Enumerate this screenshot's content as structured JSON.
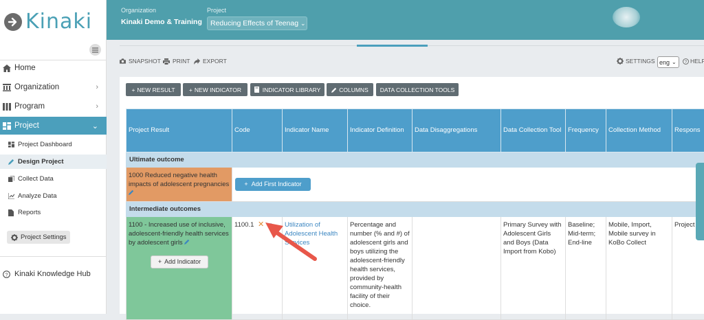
{
  "app": {
    "logo_text": "Kinaki"
  },
  "sidebar": {
    "items": [
      {
        "label": "Home"
      },
      {
        "label": "Organization"
      },
      {
        "label": "Program"
      },
      {
        "label": "Project"
      }
    ],
    "sub_items": [
      {
        "label": "Project Dashboard"
      },
      {
        "label": "Design Project"
      },
      {
        "label": "Collect Data"
      },
      {
        "label": "Analyze Data"
      },
      {
        "label": "Reports"
      }
    ],
    "project_settings": "Project Settings",
    "knowledge_hub": "Kinaki Knowledge Hub"
  },
  "header": {
    "org_label": "Organization",
    "org_value": "Kinaki Demo & Training",
    "project_label": "Project",
    "project_value": "Reducing Effects of Teenag"
  },
  "toolbar": {
    "snapshot": "SNAPSHOT",
    "print": "PRINT",
    "export": "EXPORT",
    "settings": "SETTINGS",
    "language": "eng",
    "help": "HELP"
  },
  "actions": {
    "new_result": "NEW RESULT",
    "new_indicator": "NEW INDICATOR",
    "indicator_library": "INDICATOR LIBRARY",
    "columns": "COLUMNS",
    "data_collection_tools": "DATA COLLECTION TOOLS"
  },
  "table": {
    "headers": [
      "Project Result",
      "Code",
      "Indicator Name",
      "Indicator Definition",
      "Data Disaggregations",
      "Data Collection Tool",
      "Frequency",
      "Collection Method",
      "Respons"
    ],
    "group1": "Ultimate outcome",
    "result1": "1000 Reduced negative health impacts of adolescent pregnancies",
    "add_first_indicator": "Add First Indicator",
    "group2": "Intermediate outcomes",
    "result2": "1100 - Increased use of inclusive, adolescent-friendly health services by adolescent girls",
    "add_indicator": "Add Indicator",
    "row": {
      "code": "1100.1",
      "indicator_name": "Utilization of Adolescent Health Services",
      "definition": "Percentage and number (% and #) of adolescent girls and boys utilizing the adolescent-friendly health services, provided by community-health facility of their choice.",
      "disaggregations": "",
      "tool": "Primary Survey with Adolescent Girls and Boys (Data Import from Kobo)",
      "frequency": "Baseline; Mid-term; End-line",
      "method": "Mobile, Import, Mobile survey in KoBo Collect",
      "responsible": "Project"
    }
  },
  "colors": {
    "header": "#4f9fac",
    "accent": "#4b9fbc",
    "orange": "#e29a64",
    "green": "#7fc79a",
    "arrow": "#e8574a"
  }
}
